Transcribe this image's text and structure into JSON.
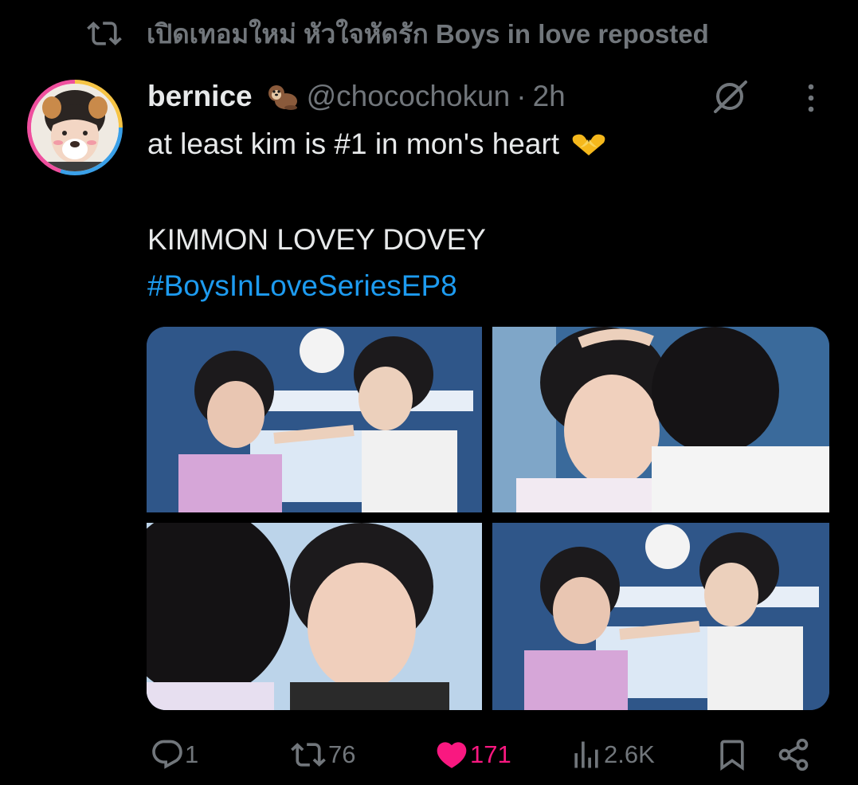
{
  "repost_banner": {
    "icon": "repost-icon",
    "text": "เปิดเทอมใหม่ หัวใจหัดรัก Boys in love reposted"
  },
  "author": {
    "display_name": "bernice",
    "name_emoji": "otter-emoji",
    "handle": "@chocochokun",
    "separator": "·",
    "time": "2h",
    "avatar": "avatar-dog-filter"
  },
  "header_icons": {
    "grok": "grok-icon",
    "more": "more-vertical-icon"
  },
  "tweet": {
    "line1": "at least kim is #1 in mon's heart",
    "line1_emoji": "heart-hands-emoji",
    "line2": "KIMMON LOVEY DOVEY",
    "hashtag": "#BoysInLoveSeriesEP8"
  },
  "media": [
    {
      "name": "photo-1"
    },
    {
      "name": "photo-2"
    },
    {
      "name": "photo-3"
    },
    {
      "name": "photo-4"
    }
  ],
  "actions": {
    "reply": {
      "icon": "reply-icon",
      "count": "1"
    },
    "repost": {
      "icon": "repost-icon",
      "count": "76"
    },
    "like": {
      "icon": "heart-icon",
      "count": "171",
      "active": true
    },
    "views": {
      "icon": "views-icon",
      "count": "2.6K"
    },
    "bookmark": {
      "icon": "bookmark-icon"
    },
    "share": {
      "icon": "share-icon"
    }
  },
  "colors": {
    "background": "#000000",
    "text": "#e7e9ea",
    "secondary": "#71767b",
    "link": "#1d9bf0",
    "like": "#f91880"
  }
}
